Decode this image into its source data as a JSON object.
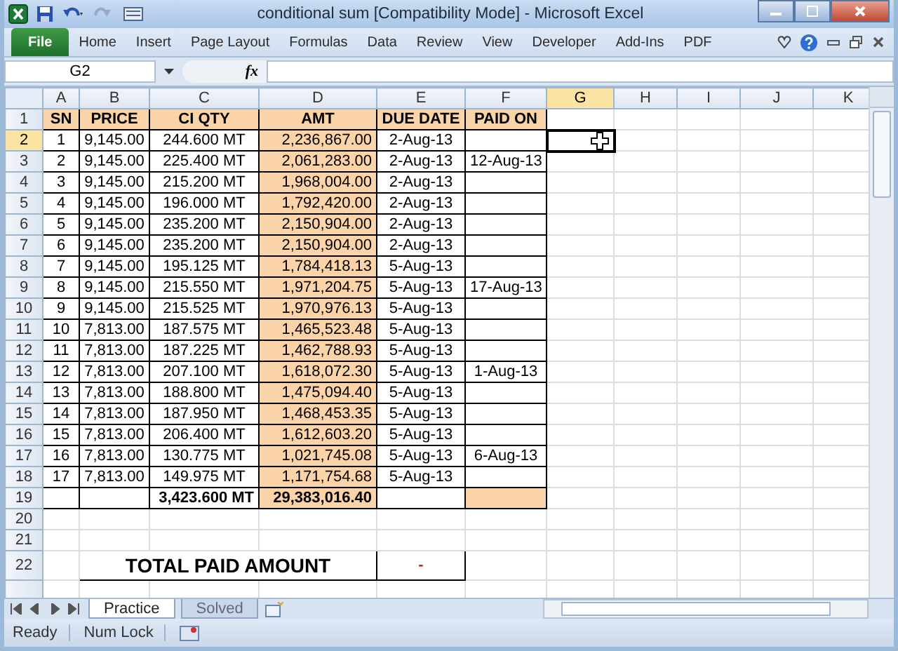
{
  "window": {
    "title": "conditional sum  [Compatibility Mode]  -  Microsoft Excel"
  },
  "ribbon_tabs": [
    {
      "label": "File",
      "selected": true
    },
    {
      "label": "Home",
      "selected": false
    },
    {
      "label": "Insert",
      "selected": false
    },
    {
      "label": "Page Layout",
      "selected": false
    },
    {
      "label": "Formulas",
      "selected": false
    },
    {
      "label": "Data",
      "selected": false
    },
    {
      "label": "Review",
      "selected": false
    },
    {
      "label": "View",
      "selected": false
    },
    {
      "label": "Developer",
      "selected": false
    },
    {
      "label": "Add-Ins",
      "selected": false
    },
    {
      "label": "PDF",
      "selected": false
    }
  ],
  "formula_bar": {
    "name_box": "G2",
    "fx": "fx"
  },
  "columns": [
    {
      "label": "A",
      "selected": false
    },
    {
      "label": "B",
      "selected": false
    },
    {
      "label": "C",
      "selected": false
    },
    {
      "label": "D",
      "selected": false
    },
    {
      "label": "E",
      "selected": false
    },
    {
      "label": "F",
      "selected": false
    },
    {
      "label": "G",
      "selected": true
    },
    {
      "label": "H",
      "selected": false
    },
    {
      "label": "I",
      "selected": false
    },
    {
      "label": "J",
      "selected": false
    },
    {
      "label": "K",
      "selected": false
    }
  ],
  "rows": [
    {
      "number": "1",
      "selected": false,
      "cells": [
        {
          "kind": "head",
          "text": "SN"
        },
        {
          "kind": "head",
          "text": "PRICE"
        },
        {
          "kind": "head",
          "text": "CI QTY"
        },
        {
          "kind": "head",
          "text": "AMT"
        },
        {
          "kind": "head",
          "text": "DUE DATE"
        },
        {
          "kind": "head",
          "text": "PAID ON"
        }
      ]
    },
    {
      "number": "2",
      "selected": true,
      "cells": [
        {
          "kind": "data",
          "text": "1"
        },
        {
          "kind": "data",
          "text": "9,145.00"
        },
        {
          "kind": "data",
          "text": "244.600 MT"
        },
        {
          "kind": "amt",
          "text": "2,236,867.00"
        },
        {
          "kind": "data",
          "text": "2-Aug-13"
        },
        {
          "kind": "data"
        }
      ]
    },
    {
      "number": "3",
      "selected": false,
      "cells": [
        {
          "kind": "data",
          "text": "2"
        },
        {
          "kind": "data",
          "text": "9,145.00"
        },
        {
          "kind": "data",
          "text": "225.400 MT"
        },
        {
          "kind": "amt",
          "text": "2,061,283.00"
        },
        {
          "kind": "data",
          "text": "2-Aug-13"
        },
        {
          "kind": "data",
          "text": "12-Aug-13"
        }
      ]
    },
    {
      "number": "4",
      "selected": false,
      "cells": [
        {
          "kind": "data",
          "text": "3"
        },
        {
          "kind": "data",
          "text": "9,145.00"
        },
        {
          "kind": "data",
          "text": "215.200 MT"
        },
        {
          "kind": "amt",
          "text": "1,968,004.00"
        },
        {
          "kind": "data",
          "text": "2-Aug-13"
        },
        {
          "kind": "data"
        }
      ]
    },
    {
      "number": "5",
      "selected": false,
      "cells": [
        {
          "kind": "data",
          "text": "4"
        },
        {
          "kind": "data",
          "text": "9,145.00"
        },
        {
          "kind": "data",
          "text": "196.000 MT"
        },
        {
          "kind": "amt",
          "text": "1,792,420.00"
        },
        {
          "kind": "data",
          "text": "2-Aug-13"
        },
        {
          "kind": "data"
        }
      ]
    },
    {
      "number": "6",
      "selected": false,
      "cells": [
        {
          "kind": "data",
          "text": "5"
        },
        {
          "kind": "data",
          "text": "9,145.00"
        },
        {
          "kind": "data",
          "text": "235.200 MT"
        },
        {
          "kind": "amt",
          "text": "2,150,904.00"
        },
        {
          "kind": "data",
          "text": "2-Aug-13"
        },
        {
          "kind": "data"
        }
      ]
    },
    {
      "number": "7",
      "selected": false,
      "cells": [
        {
          "kind": "data",
          "text": "6"
        },
        {
          "kind": "data",
          "text": "9,145.00"
        },
        {
          "kind": "data",
          "text": "235.200 MT"
        },
        {
          "kind": "amt",
          "text": "2,150,904.00"
        },
        {
          "kind": "data",
          "text": "2-Aug-13"
        },
        {
          "kind": "data"
        }
      ]
    },
    {
      "number": "8",
      "selected": false,
      "cells": [
        {
          "kind": "data",
          "text": "7"
        },
        {
          "kind": "data",
          "text": "9,145.00"
        },
        {
          "kind": "data",
          "text": "195.125 MT"
        },
        {
          "kind": "amt",
          "text": "1,784,418.13"
        },
        {
          "kind": "data",
          "text": "5-Aug-13"
        },
        {
          "kind": "data"
        }
      ]
    },
    {
      "number": "9",
      "selected": false,
      "cells": [
        {
          "kind": "data",
          "text": "8"
        },
        {
          "kind": "data",
          "text": "9,145.00"
        },
        {
          "kind": "data",
          "text": "215.550 MT"
        },
        {
          "kind": "amt",
          "text": "1,971,204.75"
        },
        {
          "kind": "data",
          "text": "5-Aug-13"
        },
        {
          "kind": "data",
          "text": "17-Aug-13"
        }
      ]
    },
    {
      "number": "10",
      "selected": false,
      "cells": [
        {
          "kind": "data",
          "text": "9"
        },
        {
          "kind": "data",
          "text": "9,145.00"
        },
        {
          "kind": "data",
          "text": "215.525 MT"
        },
        {
          "kind": "amt",
          "text": "1,970,976.13"
        },
        {
          "kind": "data",
          "text": "5-Aug-13"
        },
        {
          "kind": "data"
        }
      ]
    },
    {
      "number": "11",
      "selected": false,
      "cells": [
        {
          "kind": "data",
          "text": "10"
        },
        {
          "kind": "data",
          "text": "7,813.00"
        },
        {
          "kind": "data",
          "text": "187.575 MT"
        },
        {
          "kind": "amt",
          "text": "1,465,523.48"
        },
        {
          "kind": "data",
          "text": "5-Aug-13"
        },
        {
          "kind": "data"
        }
      ]
    },
    {
      "number": "12",
      "selected": false,
      "cells": [
        {
          "kind": "data",
          "text": "11"
        },
        {
          "kind": "data",
          "text": "7,813.00"
        },
        {
          "kind": "data",
          "text": "187.225 MT"
        },
        {
          "kind": "amt",
          "text": "1,462,788.93"
        },
        {
          "kind": "data",
          "text": "5-Aug-13"
        },
        {
          "kind": "data"
        }
      ]
    },
    {
      "number": "13",
      "selected": false,
      "cells": [
        {
          "kind": "data",
          "text": "12"
        },
        {
          "kind": "data",
          "text": "7,813.00"
        },
        {
          "kind": "data",
          "text": "207.100 MT"
        },
        {
          "kind": "amt",
          "text": "1,618,072.30"
        },
        {
          "kind": "data",
          "text": "5-Aug-13"
        },
        {
          "kind": "data",
          "text": "1-Aug-13"
        }
      ]
    },
    {
      "number": "14",
      "selected": false,
      "cells": [
        {
          "kind": "data",
          "text": "13"
        },
        {
          "kind": "data",
          "text": "7,813.00"
        },
        {
          "kind": "data",
          "text": "188.800 MT"
        },
        {
          "kind": "amt",
          "text": "1,475,094.40"
        },
        {
          "kind": "data",
          "text": "5-Aug-13"
        },
        {
          "kind": "data"
        }
      ]
    },
    {
      "number": "15",
      "selected": false,
      "cells": [
        {
          "kind": "data",
          "text": "14"
        },
        {
          "kind": "data",
          "text": "7,813.00"
        },
        {
          "kind": "data",
          "text": "187.950 MT"
        },
        {
          "kind": "amt",
          "text": "1,468,453.35"
        },
        {
          "kind": "data",
          "text": "5-Aug-13"
        },
        {
          "kind": "data"
        }
      ]
    },
    {
      "number": "16",
      "selected": false,
      "cells": [
        {
          "kind": "data",
          "text": "15"
        },
        {
          "kind": "data",
          "text": "7,813.00"
        },
        {
          "kind": "data",
          "text": "206.400 MT"
        },
        {
          "kind": "amt",
          "text": "1,612,603.20"
        },
        {
          "kind": "data",
          "text": "5-Aug-13"
        },
        {
          "kind": "data"
        }
      ]
    },
    {
      "number": "17",
      "selected": false,
      "cells": [
        {
          "kind": "data",
          "text": "16"
        },
        {
          "kind": "data",
          "text": "7,813.00"
        },
        {
          "kind": "data",
          "text": "130.775 MT"
        },
        {
          "kind": "amt",
          "text": "1,021,745.08"
        },
        {
          "kind": "data",
          "text": "5-Aug-13"
        },
        {
          "kind": "data",
          "text": "6-Aug-13"
        }
      ]
    },
    {
      "number": "18",
      "selected": false,
      "cells": [
        {
          "kind": "data",
          "text": "17"
        },
        {
          "kind": "data",
          "text": "7,813.00"
        },
        {
          "kind": "data",
          "text": "149.975 MT"
        },
        {
          "kind": "amt",
          "text": "1,171,754.68"
        },
        {
          "kind": "data",
          "text": "5-Aug-13"
        },
        {
          "kind": "data"
        }
      ]
    },
    {
      "number": "19",
      "selected": false,
      "cells": [
        {
          "kind": "data"
        },
        {
          "kind": "data"
        },
        {
          "kind": "total",
          "text": "3,423.600 MT"
        },
        {
          "kind": "totalamt",
          "text": "29,383,016.40"
        },
        {
          "kind": "data"
        },
        {
          "kind": "fill"
        }
      ]
    },
    {
      "number": "20",
      "selected": false,
      "cells": []
    },
    {
      "number": "21",
      "selected": false,
      "cells": []
    },
    {
      "number": "22",
      "selected": false,
      "cells": [
        {
          "kind": "empty"
        },
        {
          "kind": "label",
          "text": "TOTAL PAID AMOUNT"
        },
        {
          "kind": "dash",
          "text": "-"
        }
      ]
    }
  ],
  "sheet_tabs": [
    {
      "label": "Practice",
      "selected": true
    },
    {
      "label": "Solved",
      "selected": false
    }
  ],
  "status_bar": [
    "Ready",
    "Num Lock"
  ]
}
